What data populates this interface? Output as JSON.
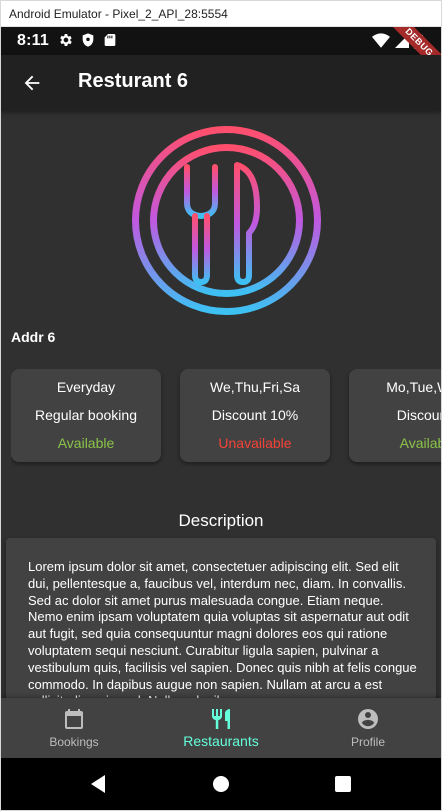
{
  "window": {
    "title": "Android Emulator - Pixel_2_API_28:5554"
  },
  "status_bar": {
    "time": "8:11",
    "icons_left": [
      "gear-icon",
      "shield-icon",
      "sim-card-icon"
    ],
    "icons_right": [
      "wifi-icon",
      "cellular-signal-icon",
      "battery-icon"
    ],
    "debug_banner": "DEBUG"
  },
  "app_bar": {
    "back_icon": "arrow-back-icon",
    "title": "Resturant 6"
  },
  "restaurant": {
    "logo_icon": "fork-and-knife-plate-icon",
    "address": "Addr 6"
  },
  "bookings": [
    {
      "days": "Everyday",
      "type": "Regular booking",
      "status": "Available"
    },
    {
      "days": "We,Thu,Fri,Sa",
      "type": "Discount 10%",
      "status": "Unavailable"
    },
    {
      "days": "Mo,Tue,We,",
      "type": "Discount",
      "status": "Availabl"
    }
  ],
  "description": {
    "heading": "Description",
    "text": "Lorem ipsum dolor sit amet, consectetuer adipiscing elit. Sed elit dui, pellentesque a, faucibus vel, interdum nec, diam. In convallis. Sed ac dolor sit amet purus malesuada congue. Etiam neque. Nemo enim ipsam voluptatem quia voluptas sit aspernatur aut odit aut fugit, sed quia consequuntur magni dolores eos qui ratione voluptatem sequi nesciunt. Curabitur ligula sapien, pulvinar a vestibulum quis, facilisis vel sapien. Donec quis nibh at felis congue commodo. In dapibus augue non sapien. Nullam at arcu a est sollicitudin euismod. Nullam dapibus"
  },
  "bottom_nav": {
    "items": [
      {
        "label": "Bookings",
        "icon": "calendar-icon",
        "active": false
      },
      {
        "label": "Restaurants",
        "icon": "restaurant-icon",
        "active": true
      },
      {
        "label": "Profile",
        "icon": "account-circle-icon",
        "active": false
      }
    ]
  },
  "system_nav": {
    "buttons": [
      "back-triangle-icon",
      "home-circle-icon",
      "recents-square-icon"
    ]
  },
  "colors": {
    "background": "#303030",
    "app_bar": "#212121",
    "card": "#424242",
    "available": "#8bc34a",
    "unavailable": "#f44336",
    "accent": "#64ffda",
    "logo_gradient_top": "#ff4f6d",
    "logo_gradient_bottom": "#3dc1f3"
  }
}
